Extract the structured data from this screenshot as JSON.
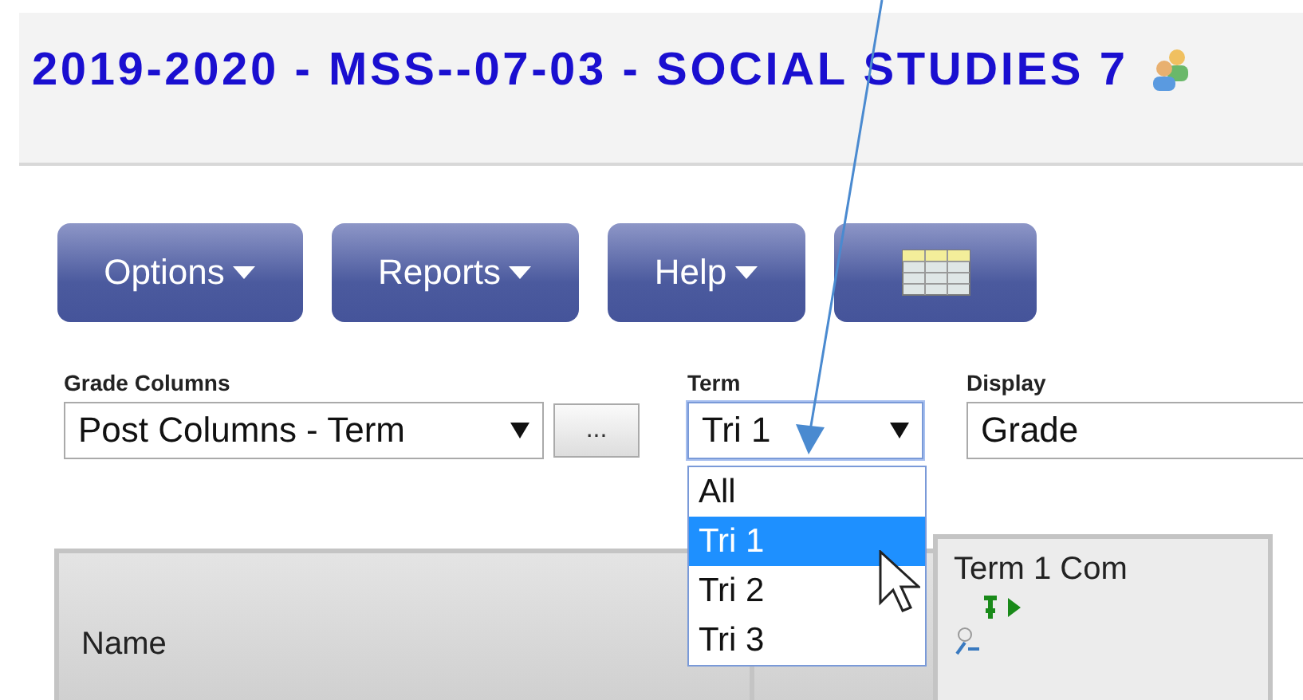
{
  "header": {
    "title": "2019-2020 - MSS--07-03 - SOCIAL STUDIES 7"
  },
  "toolbar": [
    {
      "kind": "menu",
      "label": "Options"
    },
    {
      "kind": "menu",
      "label": "Reports"
    },
    {
      "kind": "menu",
      "label": "Help"
    },
    {
      "kind": "grid"
    }
  ],
  "filters": {
    "grade_columns": {
      "label": "Grade Columns",
      "value": "Post Columns - Term",
      "more_button": "..."
    },
    "term": {
      "label": "Term",
      "value": "Tri 1",
      "expanded": true,
      "options": [
        {
          "label": "All",
          "selected": false
        },
        {
          "label": "Tri 1",
          "selected": true
        },
        {
          "label": "Tri 2",
          "selected": false
        },
        {
          "label": "Tri 3",
          "selected": false
        }
      ]
    },
    "display": {
      "label": "Display",
      "value": "Grade"
    }
  },
  "table": {
    "columns": [
      {
        "label": "Name"
      },
      {},
      {
        "label": "Term 1 Com"
      }
    ]
  }
}
